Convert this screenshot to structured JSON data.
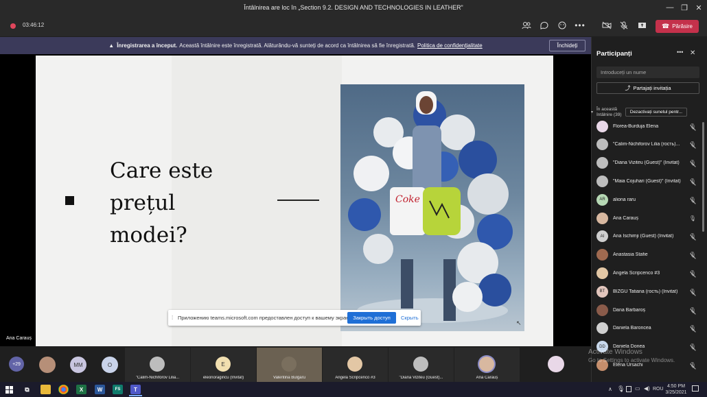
{
  "window": {
    "title": "Întâlnirea are loc în „Section 9.2. DESIGN AND TECHNOLOGIES IN LEATHER”",
    "minimize": "—",
    "maximize": "❐",
    "close": "✕"
  },
  "meeting": {
    "timer": "03:46:12",
    "leave_label": "Părăsire"
  },
  "banner": {
    "strong": "Înregistrarea a început.",
    "text": "Această întâlnire este înregistrată. Alăturându-vă sunteți de acord ca întâlnirea să fie înregistrată.",
    "link": "Politica de confidențialitate",
    "close_label": "Închideți"
  },
  "slide": {
    "title_lines": [
      "Care este",
      "prețul",
      "modei?"
    ],
    "photo_bag_text": "Coke"
  },
  "stage": {
    "speaker_name": "Ana Carauș"
  },
  "share_notice": {
    "text": "Приложению teams.microsoft.com предоставлен доступ к вашему экрану.",
    "stop_label": "Закрыть доступ",
    "hide_label": "Скрыть"
  },
  "panel": {
    "title": "Participanți",
    "search_placeholder": "Introduceți un nume",
    "invite_label": "Partajați invitația",
    "section_label": "În această întâlnire (39)",
    "mute_all_label": "Dezactivați sunetul pentr...",
    "participants": [
      {
        "name": "Florea-Burduja Elena",
        "initials": "",
        "avatar_color": "#e9d8e8",
        "mic": "off"
      },
      {
        "name": "\"Calim-Nichiforov Lilia (гость)...",
        "initials": "",
        "avatar_color": "#bdbdbd",
        "mic": "off"
      },
      {
        "name": "\"Diana Viziteu (Guest)\" (Invitat)",
        "initials": "",
        "avatar_color": "#bdbdbd",
        "mic": "off"
      },
      {
        "name": "\"Maia Cojuhari (Guest)\" (Invitat)",
        "initials": "",
        "avatar_color": "#bdbdbd",
        "mic": "off"
      },
      {
        "name": "aliona raru",
        "initials": "AR",
        "avatar_color": "#b7d9b5",
        "mic": "off"
      },
      {
        "name": "Ana Carauș",
        "initials": "",
        "avatar_color": "#d8b8a0",
        "mic": "on"
      },
      {
        "name": "Ana Ischimji (Guest) (Invitat)",
        "initials": "AI",
        "avatar_color": "#cfcfcf",
        "mic": "off"
      },
      {
        "name": "Anastasia Stafie",
        "initials": "",
        "avatar_color": "#a06a50",
        "mic": "off"
      },
      {
        "name": "Angela Scripcenco #3",
        "initials": "",
        "avatar_color": "#e3c7a5",
        "mic": "off"
      },
      {
        "name": "BÎZGU Tatiana (гость) (Invitat)",
        "initials": "BT",
        "avatar_color": "#e2c6bd",
        "mic": "off"
      },
      {
        "name": "Dana Barbaroș",
        "initials": "",
        "avatar_color": "#8a5b4a",
        "mic": "off"
      },
      {
        "name": "Daniela Baroncea",
        "initials": "",
        "avatar_color": "#cfcfcf",
        "mic": "off"
      },
      {
        "name": "Daniela Donea",
        "initials": "DD",
        "avatar_color": "#c8d8ec",
        "mic": "off"
      },
      {
        "name": "Elena Ursachi",
        "initials": "",
        "avatar_color": "#c58e6c",
        "mic": "off"
      }
    ]
  },
  "strip": {
    "overflow_count": "+29",
    "initial_tiles": [
      {
        "initials": "MM",
        "color": "#c9c6e0"
      },
      {
        "initials": "O",
        "color": "#c9d3ea"
      }
    ],
    "video_tiles": [
      {
        "label": "\"Calim-Nichiforov Lilia...",
        "initials": "",
        "color": "#bdbdbd"
      },
      {
        "label": "eleonoragincu (Invitat)",
        "initials": "E",
        "color": "#f1dfb0"
      },
      {
        "label": "Valentina Bulgaru",
        "initials": "",
        "color": "#7a6f5e"
      },
      {
        "label": "Angela Scripcenco #3",
        "initials": "",
        "color": "#e3c7a5"
      },
      {
        "label": "\"Diana Viziteu (Guest)...",
        "initials": "",
        "color": "#bdbdbd"
      },
      {
        "label": "Ana Carauș",
        "initials": "",
        "color": "#d8b8a0"
      }
    ]
  },
  "watermark": {
    "line1": "Activate Windows",
    "line2": "Go to Settings to activate Windows."
  },
  "taskbar": {
    "time": "4:50 PM",
    "date": "3/25/2021",
    "lang": "ROU",
    "apps": [
      "W",
      "X",
      "FS",
      "T"
    ]
  }
}
